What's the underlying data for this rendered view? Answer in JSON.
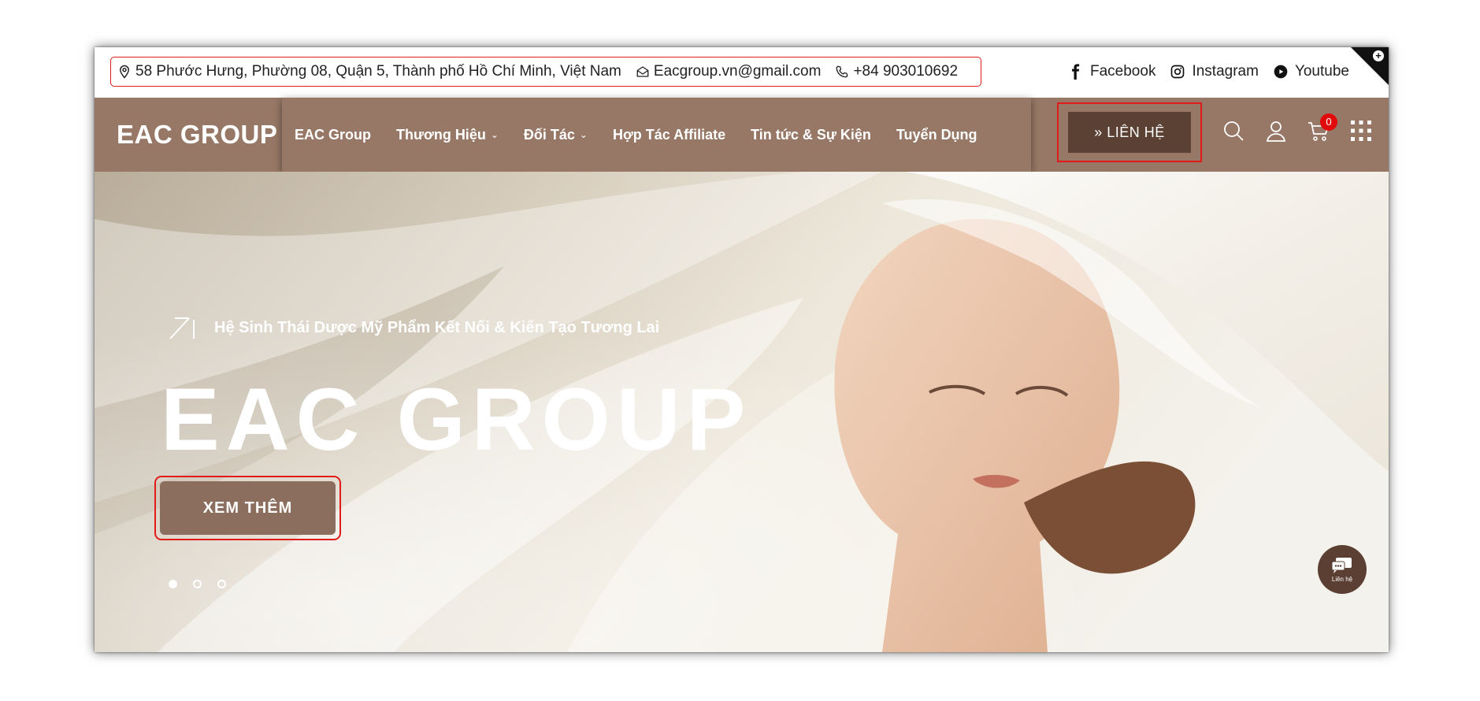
{
  "topbar": {
    "address": "58 Phước Hưng, Phường 08, Quận 5, Thành phố Hồ Chí Minh, Việt Nam",
    "email": "Eacgroup.vn@gmail.com",
    "phone": "+84 903010692",
    "social": [
      {
        "label": "Facebook",
        "icon": "facebook-icon"
      },
      {
        "label": "Instagram",
        "icon": "instagram-icon"
      },
      {
        "label": "Youtube",
        "icon": "youtube-icon"
      }
    ]
  },
  "nav": {
    "logo": "EAC GROUP",
    "menu": [
      {
        "label": "EAC Group",
        "dropdown": false
      },
      {
        "label": "Thương Hiệu",
        "dropdown": true
      },
      {
        "label": "Đối Tác",
        "dropdown": true
      },
      {
        "label": "Hợp Tác Affiliate",
        "dropdown": false
      },
      {
        "label": "Tin tức & Sự Kiện",
        "dropdown": false
      },
      {
        "label": "Tuyển Dụng",
        "dropdown": false
      }
    ],
    "contact_button": "» LIÊN HỆ",
    "cart_count": "0"
  },
  "hero": {
    "tagline": "Hệ Sinh Thái Dược Mỹ Phẩm Kết Nối & Kiến Tạo Tương Lai",
    "title": "EAC GROUP",
    "cta": "XEM THÊM",
    "slides": 3,
    "active_slide": 1
  },
  "chat_widget": {
    "label": "Liên hệ"
  },
  "colors": {
    "nav_bg": "#977866",
    "contact_btn": "#5a4134",
    "highlight_border": "#e11a1a",
    "cta_bg": "#8c6e5e"
  }
}
